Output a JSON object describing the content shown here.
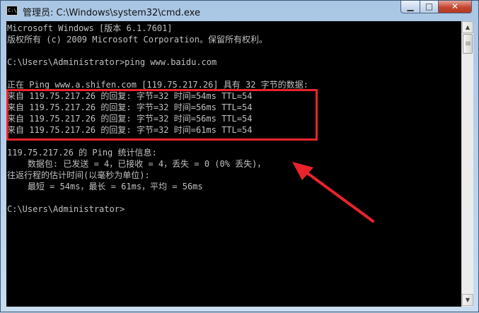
{
  "window": {
    "title": "管理员: C:\\Windows\\system32\\cmd.exe",
    "icon": "cmd-icon",
    "controls": {
      "minimize": "minimize-icon",
      "maximize": "maximize-icon",
      "close": "close-icon"
    }
  },
  "console": {
    "lines": [
      "Microsoft Windows [版本 6.1.7601]",
      "版权所有 (c) 2009 Microsoft Corporation。保留所有权利。",
      "",
      "C:\\Users\\Administrator>ping www.baidu.com",
      "",
      "正在 Ping www.a.shifen.com [119.75.217.26] 具有 32 字节的数据:",
      "来自 119.75.217.26 的回复: 字节=32 时间=54ms TTL=54",
      "来自 119.75.217.26 的回复: 字节=32 时间=56ms TTL=54",
      "来自 119.75.217.26 的回复: 字节=32 时间=56ms TTL=54",
      "来自 119.75.217.26 的回复: 字节=32 时间=61ms TTL=54",
      "",
      "119.75.217.26 的 Ping 统计信息:",
      "    数据包: 已发送 = 4，已接收 = 4，丢失 = 0 (0% 丢失)，",
      "往返行程的估计时间(以毫秒为单位):",
      "    最短 = 54ms，最长 = 61ms，平均 = 56ms",
      "",
      "C:\\Users\\Administrator>"
    ]
  },
  "annotation": {
    "box_color": "#e8242a",
    "arrow_color": "#e8242a"
  },
  "colors": {
    "console_bg": "#000000",
    "console_text": "#c0c0c0",
    "frame": "#bcd3ea"
  }
}
